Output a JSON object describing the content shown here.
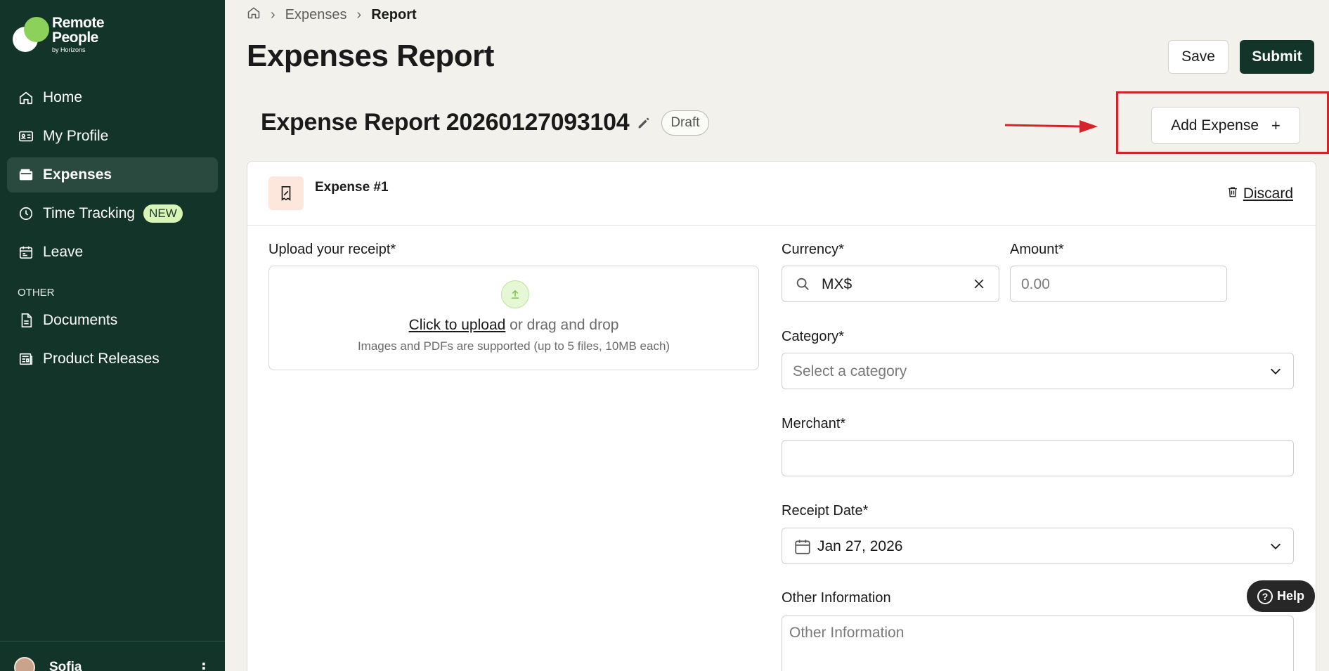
{
  "brand": {
    "logo_line1": "Remote",
    "logo_line2": "People",
    "logo_line3": "by Horizons"
  },
  "sidebar": {
    "items": [
      {
        "label": "Home",
        "icon": "home-icon"
      },
      {
        "label": "My Profile",
        "icon": "id-card-icon"
      },
      {
        "label": "Expenses",
        "icon": "wallet-icon",
        "active": true
      },
      {
        "label": "Time Tracking",
        "icon": "clock-icon",
        "badge": "NEW"
      },
      {
        "label": "Leave",
        "icon": "calendar-icon"
      }
    ],
    "section_other": "OTHER",
    "other_items": [
      {
        "label": "Documents",
        "icon": "document-icon"
      },
      {
        "label": "Product Releases",
        "icon": "newspaper-icon"
      }
    ],
    "user": {
      "name": "Sofia",
      "menu": "⋮"
    }
  },
  "breadcrumb": {
    "home_icon": "home-icon",
    "items": [
      "Expenses",
      "Report"
    ]
  },
  "header": {
    "title": "Expenses Report",
    "save_label": "Save",
    "submit_label": "Submit"
  },
  "report": {
    "name": "Expense Report 20260127093104",
    "status": "Draft",
    "add_expense_label": "Add Expense",
    "add_icon": "+"
  },
  "expense": {
    "label": "Expense #1",
    "discard_label": "Discard",
    "upload": {
      "label": "Upload your receipt*",
      "link": "Click to upload",
      "suffix": " or drag and drop",
      "hint": "Images and PDFs are supported (up to 5 files, 10MB each)"
    },
    "currency": {
      "label": "Currency*",
      "value": "MX$"
    },
    "amount": {
      "label": "Amount*",
      "placeholder": "0.00"
    },
    "category": {
      "label": "Category*",
      "placeholder": "Select a category"
    },
    "merchant": {
      "label": "Merchant*",
      "value": ""
    },
    "receipt_date": {
      "label": "Receipt Date*",
      "value": "Jan 27, 2026"
    },
    "other_info": {
      "label": "Other Information",
      "placeholder": "Other Information"
    }
  },
  "help": {
    "label": "Help"
  },
  "colors": {
    "sidebar_bg": "#133529",
    "accent_green": "#8bd15a",
    "highlight_red": "#d4232a",
    "page_bg": "#f2f1ec"
  }
}
